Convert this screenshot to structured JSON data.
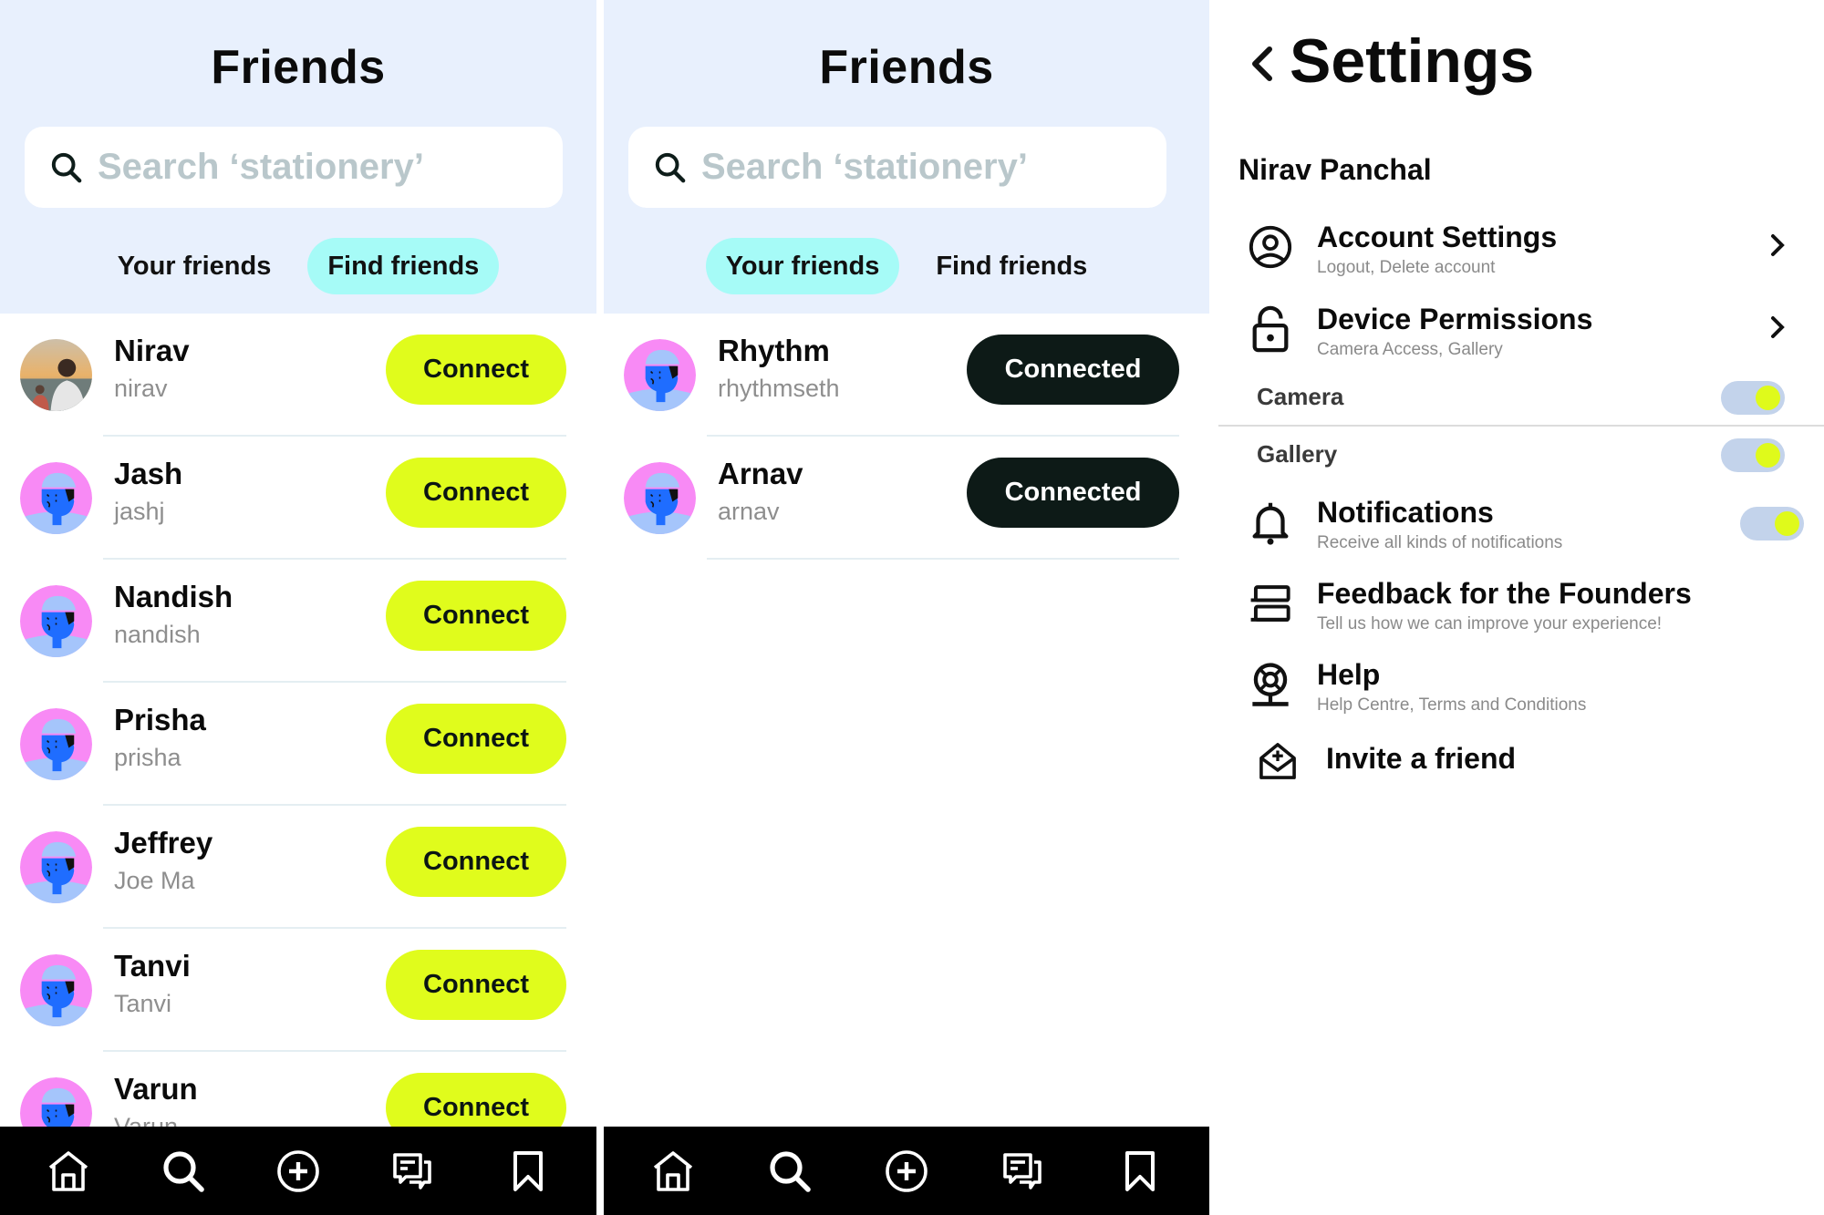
{
  "screens": [
    {
      "title": "Friends",
      "search_placeholder": "Search ‘stationery’",
      "tabs": [
        {
          "label": "Your friends",
          "active": false
        },
        {
          "label": "Find friends",
          "active": true
        }
      ],
      "rows": [
        {
          "name": "Nirav",
          "username": "nirav",
          "action": "Connect",
          "avatar": "photo"
        },
        {
          "name": "Jash",
          "username": "jashj",
          "action": "Connect",
          "avatar": "illustration"
        },
        {
          "name": "Nandish",
          "username": "nandish",
          "action": "Connect",
          "avatar": "illustration"
        },
        {
          "name": "Prisha",
          "username": "prisha",
          "action": "Connect",
          "avatar": "illustration"
        },
        {
          "name": "Jeffrey",
          "username": "Joe Ma",
          "action": "Connect",
          "avatar": "illustration"
        },
        {
          "name": "Tanvi",
          "username": "Tanvi",
          "action": "Connect",
          "avatar": "illustration"
        },
        {
          "name": "Varun",
          "username": "Varun",
          "action": "Connect",
          "avatar": "illustration"
        }
      ]
    },
    {
      "title": "Friends",
      "search_placeholder": "Search ‘stationery’",
      "tabs": [
        {
          "label": "Your friends",
          "active": true
        },
        {
          "label": "Find friends",
          "active": false
        }
      ],
      "rows": [
        {
          "name": "Rhythm",
          "username": "rhythmseth",
          "action": "Connected",
          "avatar": "illustration"
        },
        {
          "name": "Arnav",
          "username": "arnav",
          "action": "Connected",
          "avatar": "illustration"
        }
      ]
    }
  ],
  "navbar": {
    "items": [
      {
        "icon": "home-icon",
        "label": "Home"
      },
      {
        "icon": "search-icon",
        "label": "Search"
      },
      {
        "icon": "add-circle-icon",
        "label": "Create"
      },
      {
        "icon": "chat-icon",
        "label": "Messages"
      },
      {
        "icon": "bookmark-icon",
        "label": "Saved"
      }
    ]
  },
  "settings": {
    "title": "Settings",
    "user_name": "Nirav Panchal",
    "items": {
      "account": {
        "title": "Account Settings",
        "subtitle": "Logout, Delete account",
        "icon": "user-circle-icon"
      },
      "permissions": {
        "title": "Device Permissions",
        "subtitle": "Camera Access, Gallery",
        "icon": "lock-icon"
      },
      "notifications": {
        "title": "Notifications",
        "subtitle": "Receive all kinds of notifications",
        "icon": "bell-icon",
        "enabled": true
      },
      "feedback": {
        "title": "Feedback for the Founders",
        "subtitle": "Tell us how we can improve your experience!",
        "icon": "feedback-icon"
      },
      "help": {
        "title": "Help",
        "subtitle": "Help Centre, Terms and Conditions",
        "icon": "help-icon"
      },
      "invite": {
        "title": "Invite a friend",
        "icon": "invite-mail-icon"
      }
    },
    "permissions": [
      {
        "label": "Camera",
        "enabled": true
      },
      {
        "label": "Gallery",
        "enabled": true
      }
    ]
  },
  "colors": {
    "header_bg": "#e8f0fd",
    "active_tab": "#a6fbf7",
    "connect": "#e0fc1c",
    "connected": "#0d1a17",
    "toggle_track": "#c3d3eb",
    "toggle_knob": "#dffa1b"
  }
}
